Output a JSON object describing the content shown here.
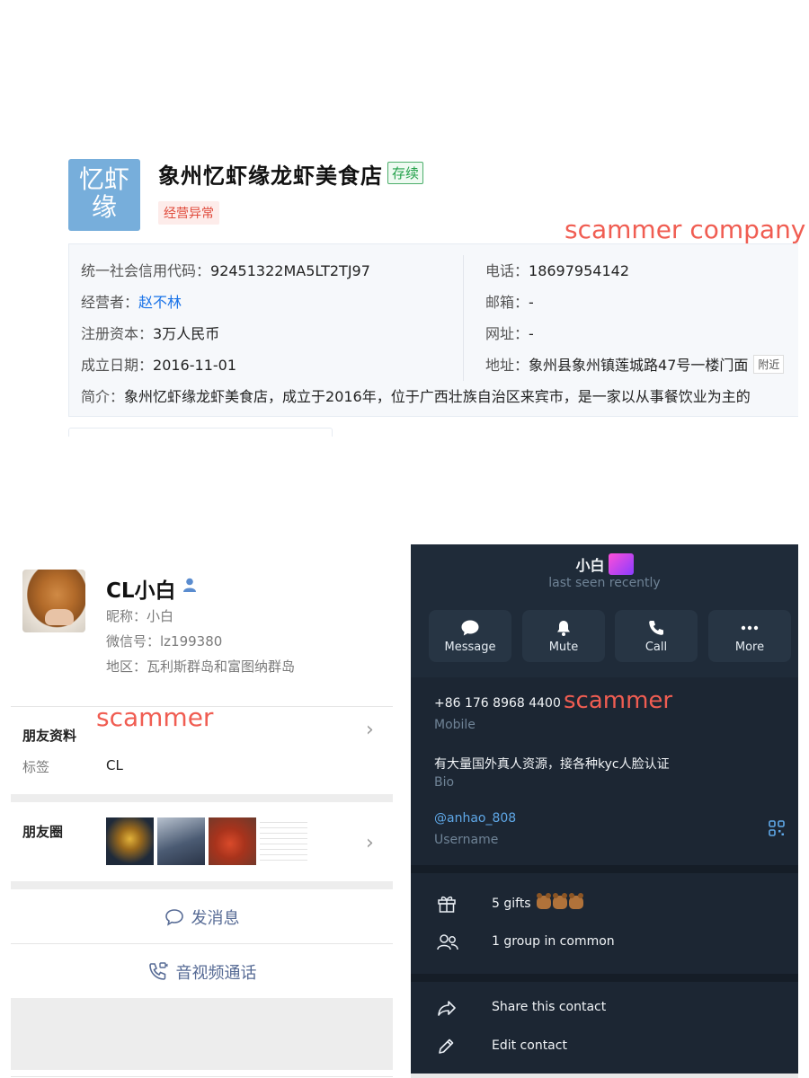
{
  "company": {
    "logo_line1": "忆虾",
    "logo_line2": "缘",
    "name": "象州忆虾缘龙虾美食店",
    "status": "存续",
    "abnormal_tag": "经营异常",
    "annotation": "scammer company",
    "credit_code_label": "统一社会信用代码：",
    "credit_code": "92451322MA5LT2TJ97",
    "operator_label": "经营者：",
    "operator": "赵不林",
    "capital_label": "注册资本：",
    "capital": "3万人民币",
    "founded_label": "成立日期：",
    "founded": "2016-11-01",
    "phone_label": "电话：",
    "phone": "18697954142",
    "email_label": "邮箱：",
    "email": "-",
    "website_label": "网址：",
    "website": "-",
    "address_label": "地址：",
    "address": "象州县象州镇莲城路47号一楼门面",
    "nearby_btn": "附近",
    "intro_label": "简介：",
    "intro": "象州忆虾缘龙虾美食店，成立于2016年，位于广西壮族自治区来宾市，是一家以从事餐饮业为主的"
  },
  "wechat": {
    "name": "CL小白",
    "nickname": "昵称：小白",
    "wechat_id": "微信号：lz199380",
    "region": "地区：瓦利斯群岛和富图纳群岛",
    "annotation": "scammer",
    "profile_label": "朋友资料",
    "tag_label": "标签",
    "tag_value": "CL",
    "moments_label": "朋友圈",
    "send_message": "发消息",
    "av_call": "音视频通话"
  },
  "telegram": {
    "name": "小白",
    "last_seen": "last seen recently",
    "buttons": [
      "Message",
      "Mute",
      "Call",
      "More"
    ],
    "phone": "+86 176 8968 4400",
    "phone_label": "Mobile",
    "annotation": "scammer",
    "bio": "有大量国外真人资源，接各种kyc人脸认证",
    "bio_label": "Bio",
    "username": "@anhao_808",
    "username_label": "Username",
    "gifts": "5 gifts",
    "groups": "1 group in common",
    "share": "Share this contact",
    "edit": "Edit contact"
  }
}
